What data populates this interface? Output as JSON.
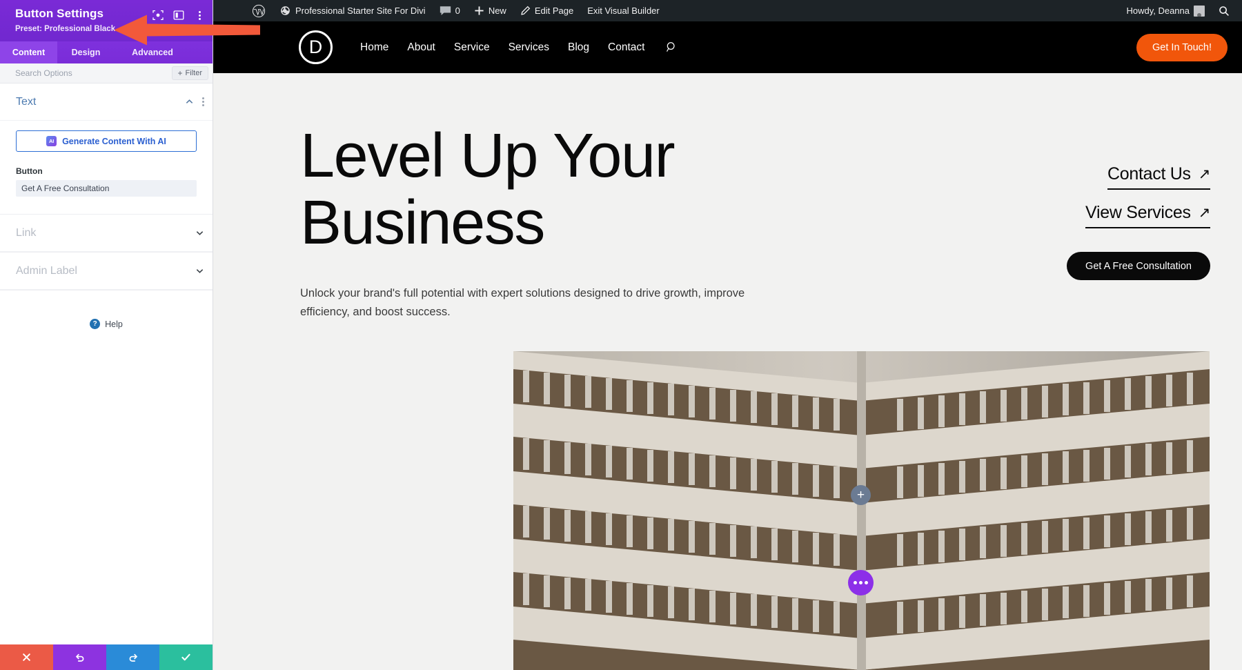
{
  "adminbar": {
    "wp_logo": "wordpress-logo-icon",
    "site_name": "Professional Starter Site For Divi",
    "comments_count": "0",
    "new_label": "New",
    "edit_page_label": "Edit Page",
    "exit_builder_label": "Exit Visual Builder",
    "howdy": "Howdy, Deanna",
    "search_icon": "search-icon",
    "background": "#1d2327"
  },
  "settings_panel": {
    "title": "Button Settings",
    "preset_label": "Preset: Professional Black",
    "header_color": "#7529d4",
    "tabs": [
      {
        "label": "Content",
        "active": true
      },
      {
        "label": "Design",
        "active": false
      },
      {
        "label": "Advanced",
        "active": false
      }
    ],
    "search": {
      "placeholder": "Search Options",
      "value": ""
    },
    "filter_label": "Filter",
    "sections": {
      "text": {
        "title": "Text",
        "expanded": true,
        "ai_button_label": "Generate Content With AI",
        "ai_badge": "AI",
        "field_label": "Button",
        "field_value": "Get A Free Consultation"
      },
      "link": {
        "title": "Link",
        "expanded": false
      },
      "admin_label": {
        "title": "Admin Label",
        "expanded": false
      }
    },
    "help_label": "Help",
    "footer_buttons": [
      {
        "name": "close",
        "icon": "close-icon",
        "color": "#eb5a46"
      },
      {
        "name": "undo",
        "icon": "undo-icon",
        "color": "#8d33e0"
      },
      {
        "name": "redo",
        "icon": "redo-icon",
        "color": "#2a8bd8"
      },
      {
        "name": "save",
        "icon": "check-icon",
        "color": "#2bbf9e"
      }
    ]
  },
  "annotation": {
    "type": "arrow",
    "color": "#f2593a",
    "points_to": "preset-professional-black"
  },
  "site": {
    "logo_letter": "D",
    "nav": [
      {
        "label": "Home"
      },
      {
        "label": "About"
      },
      {
        "label": "Service"
      },
      {
        "label": "Services"
      },
      {
        "label": "Blog"
      },
      {
        "label": "Contact"
      }
    ],
    "nav_search_icon": "search-icon",
    "cta_label": "Get In Touch!",
    "cta_color": "#f1560b",
    "hero": {
      "title_line1": "Level Up Your",
      "title_line2": "Business",
      "subtitle": "Unlock your brand's full potential with expert solutions designed to drive growth, improve efficiency, and boost success.",
      "link_contact": "Contact Us",
      "link_services": "View Services",
      "arrow_glyph": "↗",
      "button_label": "Get A Free Consultation"
    },
    "floating": {
      "add_icon": "plus-icon",
      "add_color": "#6b7b93",
      "more_icon": "ellipsis-icon",
      "more_color": "#8c2fe8"
    }
  }
}
